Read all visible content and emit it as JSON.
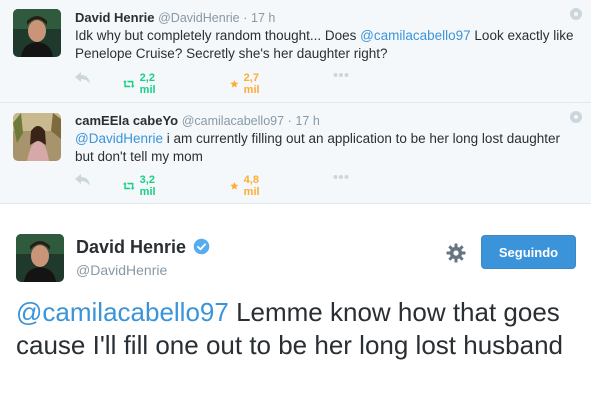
{
  "tweets": [
    {
      "name": "David Henrie",
      "handle": "@DavidHenrie",
      "separator": "·",
      "time": "17 h",
      "mention": "@camilacabello97",
      "text_before": "Idk why but completely random thought... Does ",
      "text_after": " Look exactly like Penelope Cruise? Secretly she's her daughter right?",
      "retweets": "2,2 mil",
      "favorites": "2,7 mil"
    },
    {
      "name": "camEEla cabeYo",
      "handle": "@camilacabello97",
      "separator": "·",
      "time": "17 h",
      "mention": "@DavidHenrie",
      "text_before": "",
      "text_after": " i am currently filling out an application to be her long lost daughter but don't tell my mom",
      "retweets": "3,2 mil",
      "favorites": "4,8 mil"
    }
  ],
  "main_tweet": {
    "name": "David Henrie",
    "handle": "@DavidHenrie",
    "follow_label": "Seguindo",
    "mention": "@camilacabello97",
    "text_after": " Lemme know how that goes cause I'll fill one out to be her long lost husband"
  },
  "colors": {
    "link": "#3b94d9",
    "retweet": "#19cf86",
    "favorite": "#ffac33",
    "button": "#3b94d9"
  },
  "icons": [
    "reply-icon",
    "retweet-icon",
    "star-icon",
    "more-icon",
    "gear-icon",
    "verified-icon"
  ]
}
